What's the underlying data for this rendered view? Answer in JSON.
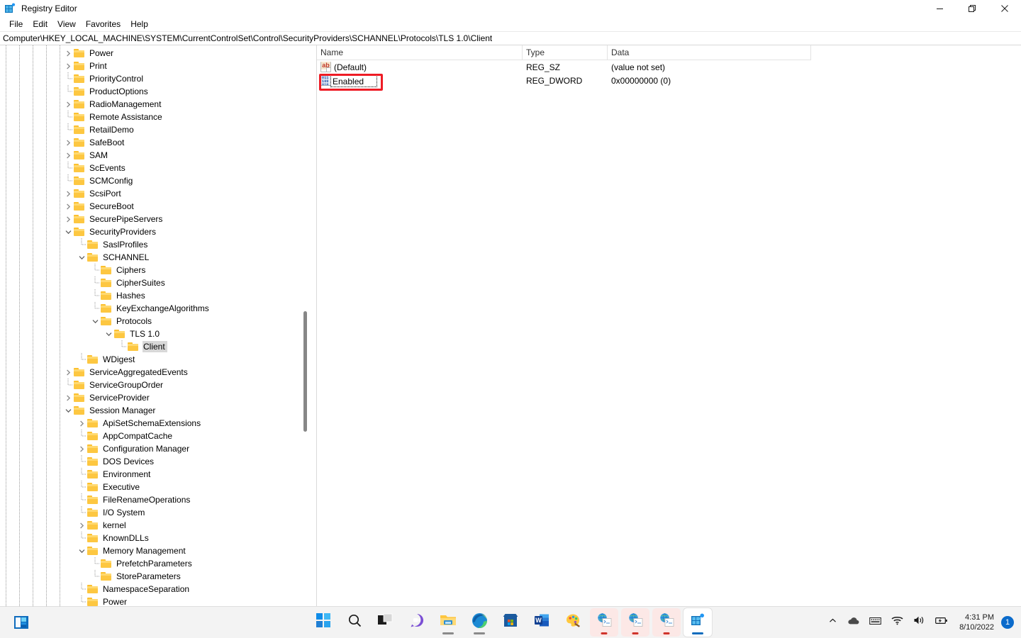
{
  "window": {
    "title": "Registry Editor",
    "app_icon": "registry-editor-icon",
    "controls": {
      "minimize": "minimize-button",
      "restore": "restore-button",
      "close": "close-button"
    }
  },
  "menu": {
    "items": [
      {
        "label": "File"
      },
      {
        "label": "Edit"
      },
      {
        "label": "View"
      },
      {
        "label": "Favorites"
      },
      {
        "label": "Help"
      }
    ]
  },
  "address": {
    "path": "Computer\\HKEY_LOCAL_MACHINE\\SYSTEM\\CurrentControlSet\\Control\\SecurityProviders\\SCHANNEL\\Protocols\\TLS 1.0\\Client"
  },
  "tree": {
    "items": [
      {
        "label": "Power",
        "indent": 0,
        "state": "collapsed"
      },
      {
        "label": "Print",
        "indent": 0,
        "state": "collapsed"
      },
      {
        "label": "PriorityControl",
        "indent": 0,
        "state": "leaf"
      },
      {
        "label": "ProductOptions",
        "indent": 0,
        "state": "leaf"
      },
      {
        "label": "RadioManagement",
        "indent": 0,
        "state": "collapsed"
      },
      {
        "label": "Remote Assistance",
        "indent": 0,
        "state": "leaf"
      },
      {
        "label": "RetailDemo",
        "indent": 0,
        "state": "leaf"
      },
      {
        "label": "SafeBoot",
        "indent": 0,
        "state": "collapsed"
      },
      {
        "label": "SAM",
        "indent": 0,
        "state": "collapsed"
      },
      {
        "label": "ScEvents",
        "indent": 0,
        "state": "leaf"
      },
      {
        "label": "SCMConfig",
        "indent": 0,
        "state": "leaf"
      },
      {
        "label": "ScsiPort",
        "indent": 0,
        "state": "collapsed"
      },
      {
        "label": "SecureBoot",
        "indent": 0,
        "state": "collapsed"
      },
      {
        "label": "SecurePipeServers",
        "indent": 0,
        "state": "collapsed"
      },
      {
        "label": "SecurityProviders",
        "indent": 0,
        "state": "expanded"
      },
      {
        "label": "SaslProfiles",
        "indent": 1,
        "state": "leaf"
      },
      {
        "label": "SCHANNEL",
        "indent": 1,
        "state": "expanded"
      },
      {
        "label": "Ciphers",
        "indent": 2,
        "state": "leaf"
      },
      {
        "label": "CipherSuites",
        "indent": 2,
        "state": "leaf"
      },
      {
        "label": "Hashes",
        "indent": 2,
        "state": "leaf"
      },
      {
        "label": "KeyExchangeAlgorithms",
        "indent": 2,
        "state": "leaf"
      },
      {
        "label": "Protocols",
        "indent": 2,
        "state": "expanded"
      },
      {
        "label": "TLS 1.0",
        "indent": 3,
        "state": "expanded"
      },
      {
        "label": "Client",
        "indent": 4,
        "state": "leaf",
        "selected": true
      },
      {
        "label": "WDigest",
        "indent": 1,
        "state": "leaf"
      },
      {
        "label": "ServiceAggregatedEvents",
        "indent": 0,
        "state": "collapsed"
      },
      {
        "label": "ServiceGroupOrder",
        "indent": 0,
        "state": "leaf"
      },
      {
        "label": "ServiceProvider",
        "indent": 0,
        "state": "collapsed"
      },
      {
        "label": "Session Manager",
        "indent": 0,
        "state": "expanded"
      },
      {
        "label": "ApiSetSchemaExtensions",
        "indent": 1,
        "state": "collapsed"
      },
      {
        "label": "AppCompatCache",
        "indent": 1,
        "state": "leaf"
      },
      {
        "label": "Configuration Manager",
        "indent": 1,
        "state": "collapsed"
      },
      {
        "label": "DOS Devices",
        "indent": 1,
        "state": "leaf"
      },
      {
        "label": "Environment",
        "indent": 1,
        "state": "leaf"
      },
      {
        "label": "Executive",
        "indent": 1,
        "state": "leaf"
      },
      {
        "label": "FileRenameOperations",
        "indent": 1,
        "state": "leaf"
      },
      {
        "label": "I/O System",
        "indent": 1,
        "state": "leaf"
      },
      {
        "label": "kernel",
        "indent": 1,
        "state": "collapsed"
      },
      {
        "label": "KnownDLLs",
        "indent": 1,
        "state": "leaf"
      },
      {
        "label": "Memory Management",
        "indent": 1,
        "state": "expanded"
      },
      {
        "label": "PrefetchParameters",
        "indent": 2,
        "state": "leaf"
      },
      {
        "label": "StoreParameters",
        "indent": 2,
        "state": "leaf"
      },
      {
        "label": "NamespaceSeparation",
        "indent": 1,
        "state": "leaf"
      },
      {
        "label": "Power",
        "indent": 1,
        "state": "leaf"
      }
    ]
  },
  "values": {
    "columns": [
      "Name",
      "Type",
      "Data"
    ],
    "rows": [
      {
        "name": "(Default)",
        "type": "REG_SZ",
        "data": "(value not set)",
        "icon": "reg-sz-icon",
        "editing": false
      },
      {
        "name": "Enabled",
        "type": "REG_DWORD",
        "data": "0x00000000 (0)",
        "icon": "reg-dword-icon",
        "editing": true,
        "annotated": true
      }
    ]
  },
  "annotation": {
    "color": "#ee1c25",
    "target": "Enabled"
  },
  "taskbar": {
    "widgets_label": "widgets-button",
    "items": [
      {
        "name": "start-button",
        "icon": "windows-logo-icon",
        "state": "idle"
      },
      {
        "name": "search-button",
        "icon": "search-icon",
        "state": "idle"
      },
      {
        "name": "task-view-button",
        "icon": "task-view-icon",
        "state": "idle"
      },
      {
        "name": "chat-button",
        "icon": "chat-teams-icon",
        "state": "idle"
      },
      {
        "name": "file-explorer-button",
        "icon": "file-explorer-icon",
        "state": "running"
      },
      {
        "name": "edge-button",
        "icon": "microsoft-edge-icon",
        "state": "running"
      },
      {
        "name": "store-button",
        "icon": "microsoft-store-icon",
        "state": "idle"
      },
      {
        "name": "word-button",
        "icon": "microsoft-word-icon",
        "state": "idle"
      },
      {
        "name": "paint-button",
        "icon": "paint-icon",
        "state": "idle"
      },
      {
        "name": "html-doc-button-1",
        "icon": "html-document-icon",
        "state": "running-pink"
      },
      {
        "name": "html-doc-button-2",
        "icon": "html-document-icon",
        "state": "running-pink"
      },
      {
        "name": "html-doc-button-3",
        "icon": "html-document-icon",
        "state": "running-pink"
      },
      {
        "name": "registry-editor-button",
        "icon": "registry-editor-icon",
        "state": "active"
      }
    ]
  },
  "tray": {
    "chevron": "show-hidden-icons",
    "onedrive": "onedrive-icon",
    "keyboard": "ime-keyboard-icon",
    "wifi": "wifi-icon",
    "volume": "volume-icon",
    "battery": "battery-charging-icon",
    "time": "4:31 PM",
    "date": "8/10/2022",
    "notification_count": "1"
  }
}
